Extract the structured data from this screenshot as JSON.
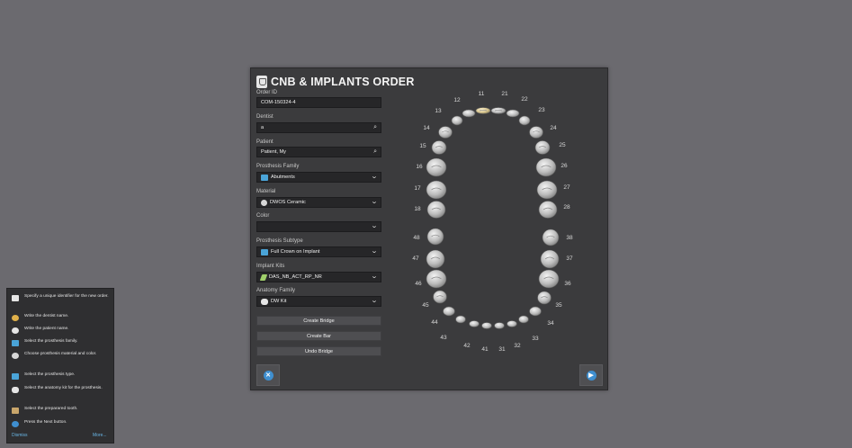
{
  "dialog": {
    "title": "CNB & IMPLANTS ORDER",
    "order_id": {
      "label": "Order ID",
      "value": "COM-150324-4"
    },
    "dentist": {
      "label": "Dentist",
      "value": "a"
    },
    "patient": {
      "label": "Patient",
      "value": "Patient, My"
    },
    "prosthesis_family": {
      "label": "Prosthesis Family",
      "value": "Abutments"
    },
    "material": {
      "label": "Material",
      "value": "DWOS Ceramic"
    },
    "color": {
      "label": "Color",
      "value": ""
    },
    "prosthesis_subtype": {
      "label": "Prosthesis Subtype",
      "value": "Full Crown on Implant"
    },
    "implant_kits": {
      "label": "Implant Kits",
      "value": "DAS_NB_ACT_RP_NR"
    },
    "anatomy_family": {
      "label": "Anatomy Family",
      "value": "DW Kit"
    },
    "create_bridge": "Create Bridge",
    "create_bar": "Create Bar",
    "undo_bridge": "Undo Bridge"
  },
  "teeth": {
    "upper": [
      "18",
      "17",
      "16",
      "15",
      "14",
      "13",
      "12",
      "11",
      "21",
      "22",
      "23",
      "24",
      "25",
      "26",
      "27",
      "28"
    ],
    "lower": [
      "48",
      "47",
      "46",
      "45",
      "44",
      "43",
      "42",
      "41",
      "31",
      "32",
      "33",
      "34",
      "35",
      "36",
      "37",
      "38"
    ]
  },
  "help": {
    "items": [
      {
        "icon": "order-id-icon",
        "text": "Specify a unique identifier for the new order."
      },
      {
        "icon": "dentist-icon",
        "text": "Write the dentist name."
      },
      {
        "icon": "patient-icon",
        "text": "Write the patient name."
      },
      {
        "icon": "prosthesis-family-icon",
        "text": "Select the prosthesis family."
      },
      {
        "icon": "material-icon",
        "text": "Choose prosthesis material and color."
      },
      {
        "icon": "prosthesis-type-icon",
        "text": "Select the prosthesis type."
      },
      {
        "icon": "anatomy-kit-icon",
        "text": "Select the anatomy kit for the prosthesis."
      },
      {
        "icon": "tooth-icon",
        "text": "Select the preparared tooth."
      },
      {
        "icon": "next-icon",
        "text": "Press the Next button."
      }
    ],
    "dismiss": "Dismiss",
    "more": "More..."
  },
  "colors": {
    "background": "#6b6a6f",
    "dialog": "#3b3b3d",
    "accent": "#3f8fd0",
    "link": "#69b6e6"
  }
}
